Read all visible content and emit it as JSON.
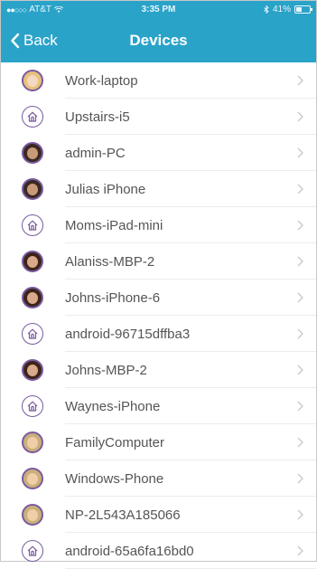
{
  "status_bar": {
    "carrier": "AT&T",
    "time": "3:35 PM",
    "battery_text": "41%",
    "battery_level": 0.41
  },
  "nav": {
    "back_label": "Back",
    "title": "Devices"
  },
  "colors": {
    "accent": "#2aa3c9",
    "avatar_ring": "#7a5aa0"
  },
  "devices": [
    {
      "name": "Work-laptop",
      "icon": "user-avatar-blonde"
    },
    {
      "name": "Upstairs-i5",
      "icon": "home-icon"
    },
    {
      "name": "admin-PC",
      "icon": "user-avatar-bearded"
    },
    {
      "name": "Julias iPhone",
      "icon": "user-avatar-bearded"
    },
    {
      "name": "Moms-iPad-mini",
      "icon": "home-icon"
    },
    {
      "name": "Alaniss-MBP-2",
      "icon": "user-avatar-dark-hair"
    },
    {
      "name": "Johns-iPhone-6",
      "icon": "user-avatar-dark-hair"
    },
    {
      "name": "android-96715dffba3",
      "icon": "home-icon"
    },
    {
      "name": "Johns-MBP-2",
      "icon": "user-avatar-dark-hair"
    },
    {
      "name": "Waynes-iPhone",
      "icon": "home-icon"
    },
    {
      "name": "FamilyComputer",
      "icon": "user-avatar-glasses"
    },
    {
      "name": "Windows-Phone",
      "icon": "user-avatar-glasses"
    },
    {
      "name": "NP-2L543A185066",
      "icon": "user-avatar-glasses"
    },
    {
      "name": "android-65a6fa16bd0",
      "icon": "home-icon"
    }
  ]
}
